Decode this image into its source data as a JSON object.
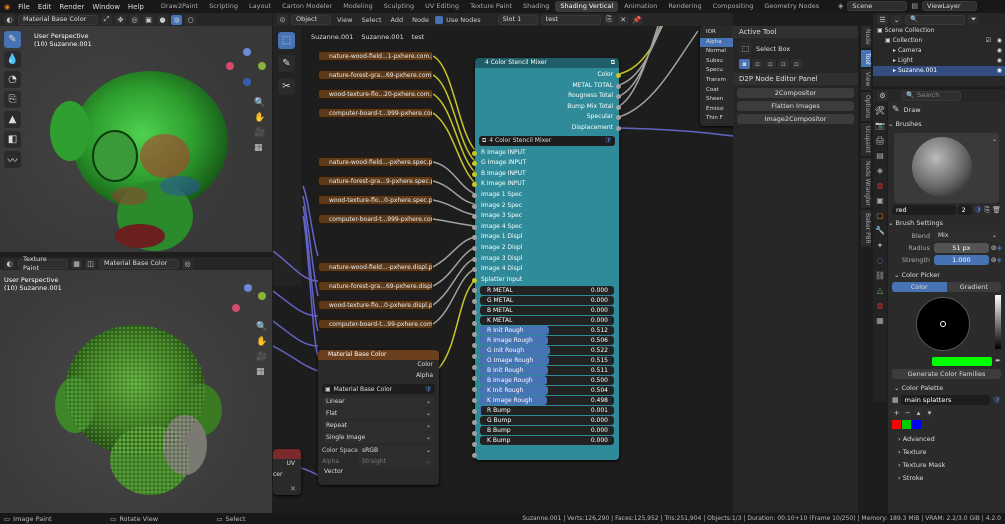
{
  "menu": {
    "items": [
      "File",
      "Edit",
      "Render",
      "Window",
      "Help"
    ]
  },
  "workspaces": [
    "Draw2Paint",
    "Scripting",
    "Layout",
    "Carton Modeler",
    "Modeling",
    "Sculpting",
    "UV Editing",
    "Texture Paint",
    "Shading",
    "Shading Vertical",
    "Animation",
    "Rendering",
    "Compositing",
    "Geometry Nodes"
  ],
  "active_workspace": "Shading Vertical",
  "scene": {
    "label": "Scene",
    "view_layer": "ViewLayer"
  },
  "viewport_top": {
    "mode": "Material Base Color",
    "title": "User Perspective",
    "object": "(10) Suzanne.001"
  },
  "viewport_bottom": {
    "mode": "Texture Paint",
    "material": "Material Base Color",
    "title": "User Perspective",
    "object": "(10) Suzanne.001"
  },
  "node_editor": {
    "type": "Object",
    "menus": [
      "View",
      "Select",
      "Add",
      "Node"
    ],
    "use_nodes_label": "Use Nodes",
    "slot": "Slot 1",
    "material": "test",
    "breadcrumb": [
      "Suzanne.001",
      "Suzanne.001",
      "test"
    ],
    "image_nodes_a": [
      "nature-wood-field...1-pxhere.com.jpg",
      "nature-forest-gra...69-pxhere.com.jpg",
      "wood-texture-flo...20-pxhere.com.jpg",
      "computer-board-t...999-pxhere.com.j"
    ],
    "image_nodes_b": [
      "nature-wood-field...-pxhere.spec.png",
      "nature-forest-gra...9-pxhere.spec.png",
      "wood-texture-flo...0-pxhere.spec.png",
      "computer-board-t...999-pxhere.com.s"
    ],
    "image_nodes_c": [
      "nature-wood-field...-pxhere.displ.png",
      "nature-forest-gra...69-pxhere.displ.pn",
      "wood-texture-flo...0-pxhere.displ.png",
      "computer-board-t...99-pxhere.com.d"
    ]
  },
  "mixer": {
    "title": "4 Color Stencil Mixer",
    "group_name": "4 Color Stencil Mixer",
    "outputs": [
      "Color",
      "METAL TOTAL",
      "Rougness Total",
      "Bump Mix Total",
      "Specular",
      "Displacement"
    ],
    "inputs": [
      "R Image INPUT",
      "G Image INPUT",
      "B Image INPUT",
      "K Image INPUT",
      "Image 1 Spec",
      "Image 2 Spec",
      "Image 3 Spec",
      "Image 4 Spec",
      "Image 1 Displ",
      "Image 2 Displ",
      "Image 3 Displ",
      "Image 4 Displ",
      "Splatter Input"
    ],
    "values": [
      {
        "label": "R METAL",
        "value": "0.000",
        "fill": 0
      },
      {
        "label": "G METAL",
        "value": "0.000",
        "fill": 0
      },
      {
        "label": "B METAL",
        "value": "0.000",
        "fill": 0
      },
      {
        "label": "K METAL",
        "value": "0.000",
        "fill": 0
      },
      {
        "label": "R Init Rough",
        "value": "0.512",
        "fill": 0.512
      },
      {
        "label": "R Image Rough",
        "value": "0.506",
        "fill": 0.506
      },
      {
        "label": "G Init Rough",
        "value": "0.522",
        "fill": 0.522
      },
      {
        "label": "G Image Rough",
        "value": "0.515",
        "fill": 0.515
      },
      {
        "label": "B Init Rough",
        "value": "0.511",
        "fill": 0.511
      },
      {
        "label": "B Image Rough",
        "value": "0.500",
        "fill": 0.5
      },
      {
        "label": "K Init Rough",
        "value": "0.504",
        "fill": 0.504
      },
      {
        "label": "K Image Rough",
        "value": "0.498",
        "fill": 0.498
      },
      {
        "label": "R Bump",
        "value": "0.001",
        "fill": 0.001
      },
      {
        "label": "G Bump",
        "value": "0.000",
        "fill": 0
      },
      {
        "label": "B Bump",
        "value": "0.000",
        "fill": 0
      },
      {
        "label": "K Bump",
        "value": "0.000",
        "fill": 0
      }
    ]
  },
  "bsdf_partial": {
    "items": [
      "IOR",
      "Alpha",
      "Normal",
      "Subsu",
      "Specu",
      "Transm",
      "Coat",
      "Sheen",
      "Emissi",
      "Thin F"
    ]
  },
  "base_color_node": {
    "title": "Material Base Color",
    "out_color": "Color",
    "out_alpha": "Alpha",
    "image": "Material Base Color",
    "interp": "Linear",
    "proj": "Flat",
    "ext": "Repeat",
    "source": "Single Image",
    "cs_label": "Color Space",
    "cs_value": "sRGB",
    "alpha_label": "Alpha",
    "alpha_value": "Straight",
    "vector": "Vector"
  },
  "uv_node": {
    "uv": "UV",
    "partial": "cer"
  },
  "tool_panel": {
    "title": "Active Tool",
    "tool": "Select Box",
    "d2p_title": "D2P Node Editor Panel",
    "buttons": [
      "2Compositor",
      "Flatten Images",
      "Image2Compositor"
    ]
  },
  "side_tabs": [
    "Node",
    "Tool",
    "View",
    "Options",
    "Ucupaint",
    "Node Wrangler",
    "Baker P8R"
  ],
  "outliner": {
    "search": "",
    "items": [
      "Scene Collection",
      "Collection",
      "Camera",
      "Light",
      "Suzanne.001"
    ]
  },
  "props": {
    "search": "Search",
    "tool_name": "Draw",
    "brushes": "Brushes",
    "brush_name": "red",
    "brush_users": "2",
    "brush_settings": "Brush Settings",
    "blend_label": "Blend",
    "blend_value": "Mix",
    "radius_label": "Radius",
    "radius_value": "51 px",
    "strength_label": "Strength",
    "strength_value": "1.000",
    "color_picker": "Color Picker",
    "tab_color": "Color",
    "tab_gradient": "Gradient",
    "picker_color": "#00ff00",
    "gen_button": "Generate Color Families",
    "palette": "Color Palette",
    "palette_name": "main splatters",
    "palette_colors": [
      "#ff0000",
      "#00cc00",
      "#0000ff"
    ],
    "sections": [
      "Advanced",
      "Texture",
      "Texture Mask",
      "Stroke"
    ]
  },
  "status": {
    "left": "Image Paint",
    "mid1": "Rotate View",
    "mid2": "Select",
    "info": "Suzanne.001 | Verts:126,290 | Faces:125,952 | Tris:251,904 | Objects:1/3 | Duration: 00:10+10 (Frame 10/250) | Memory: 189.3 MiB | VRAM: 2.2/3.0 GiB | 4.2.0"
  }
}
